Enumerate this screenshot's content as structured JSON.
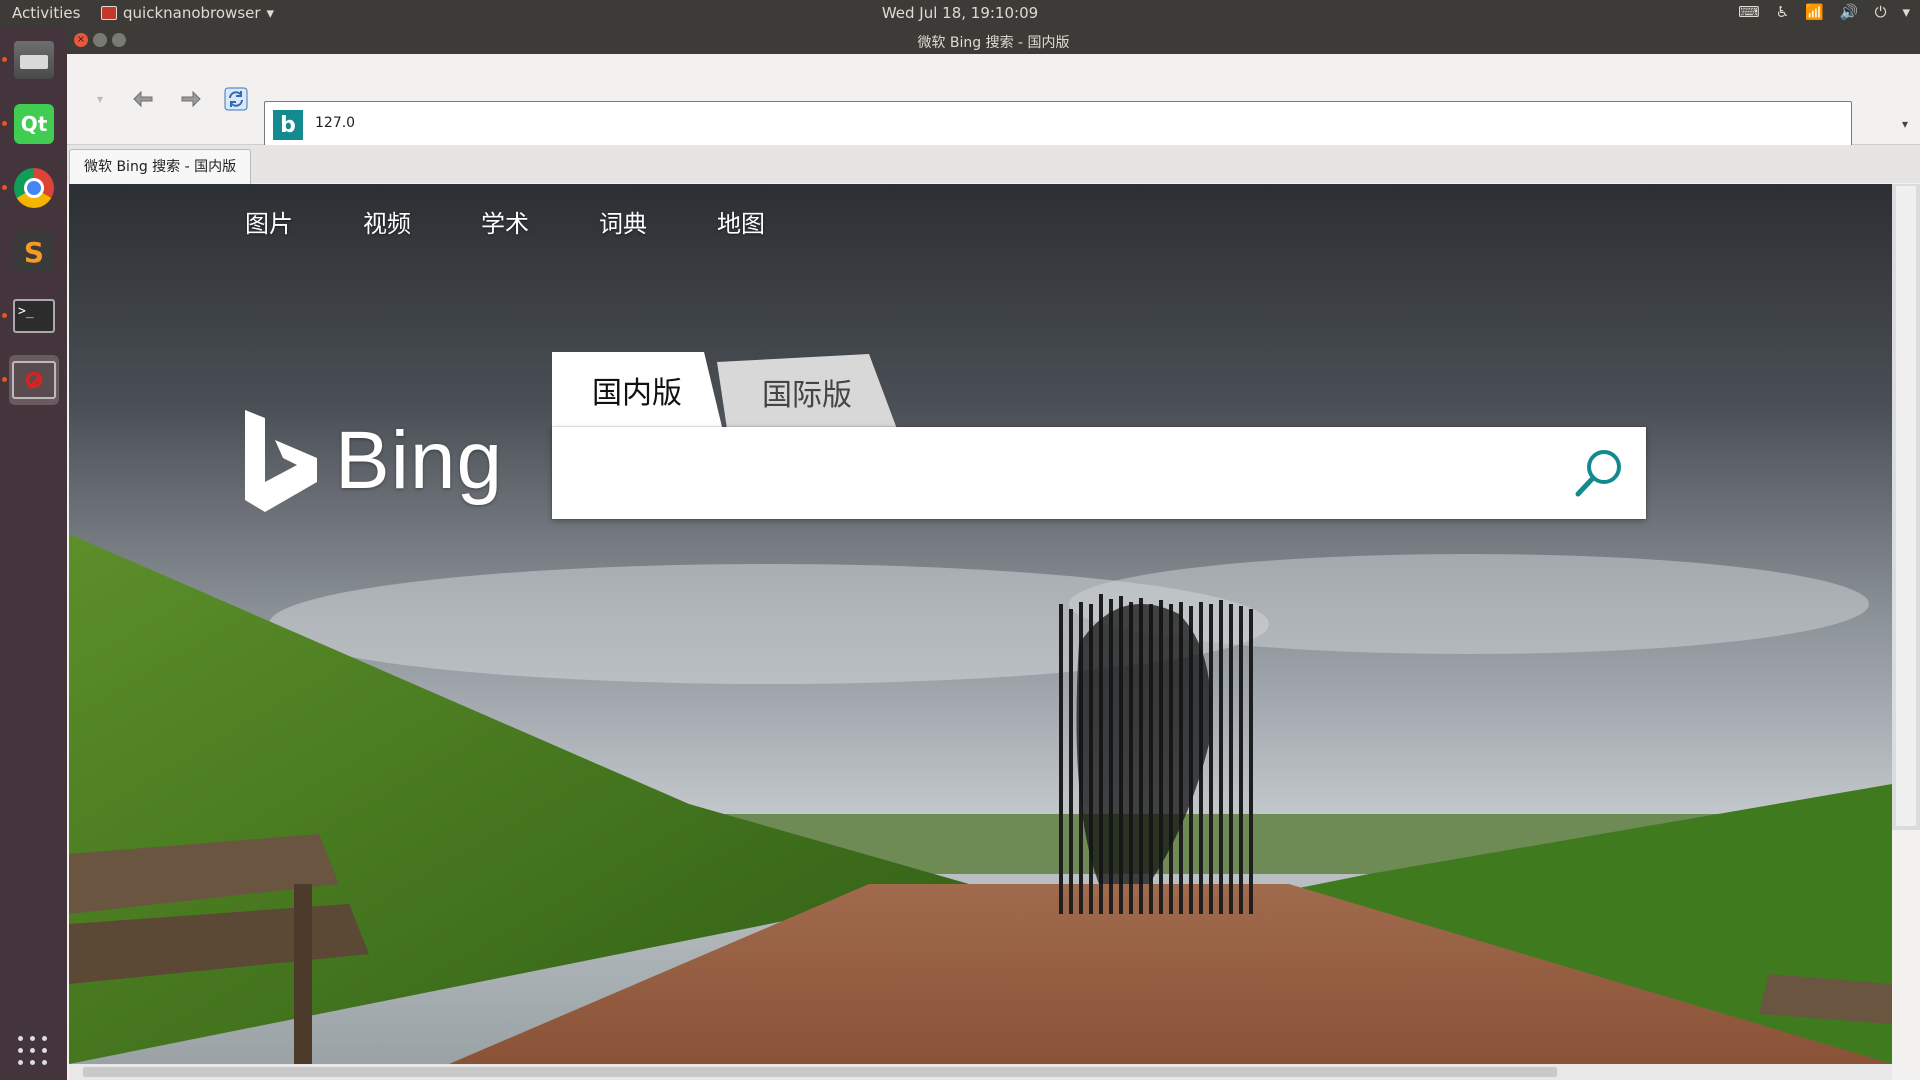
{
  "topbar": {
    "activities": "Activities",
    "app_name": "quicknanobrowser",
    "clock": "Wed Jul 18, 19:10:09"
  },
  "launcher": {
    "items": [
      "files-icon",
      "qt-creator-icon",
      "chrome-icon",
      "sublime-text-icon",
      "terminal-icon",
      "blocked-app-icon"
    ],
    "qt_label": "Qt",
    "sublime_label": "S",
    "terminal_label": ">_"
  },
  "window": {
    "title": "微软 Bing 搜索 - 国内版"
  },
  "browser": {
    "url": "127.0",
    "tab_title": "微软 Bing 搜索 - 国内版"
  },
  "page": {
    "nav": [
      "图片",
      "视频",
      "学术",
      "词典",
      "地图"
    ],
    "logo_text": "Bing",
    "search_tabs": {
      "active": "国内版",
      "inactive": "国际版"
    },
    "search_placeholder": ""
  },
  "colors": {
    "bing_teal": "#138a8f",
    "ubuntu_orange": "#e95420",
    "panel_dark": "#3c3b37",
    "launcher_bg": "#44343b"
  }
}
